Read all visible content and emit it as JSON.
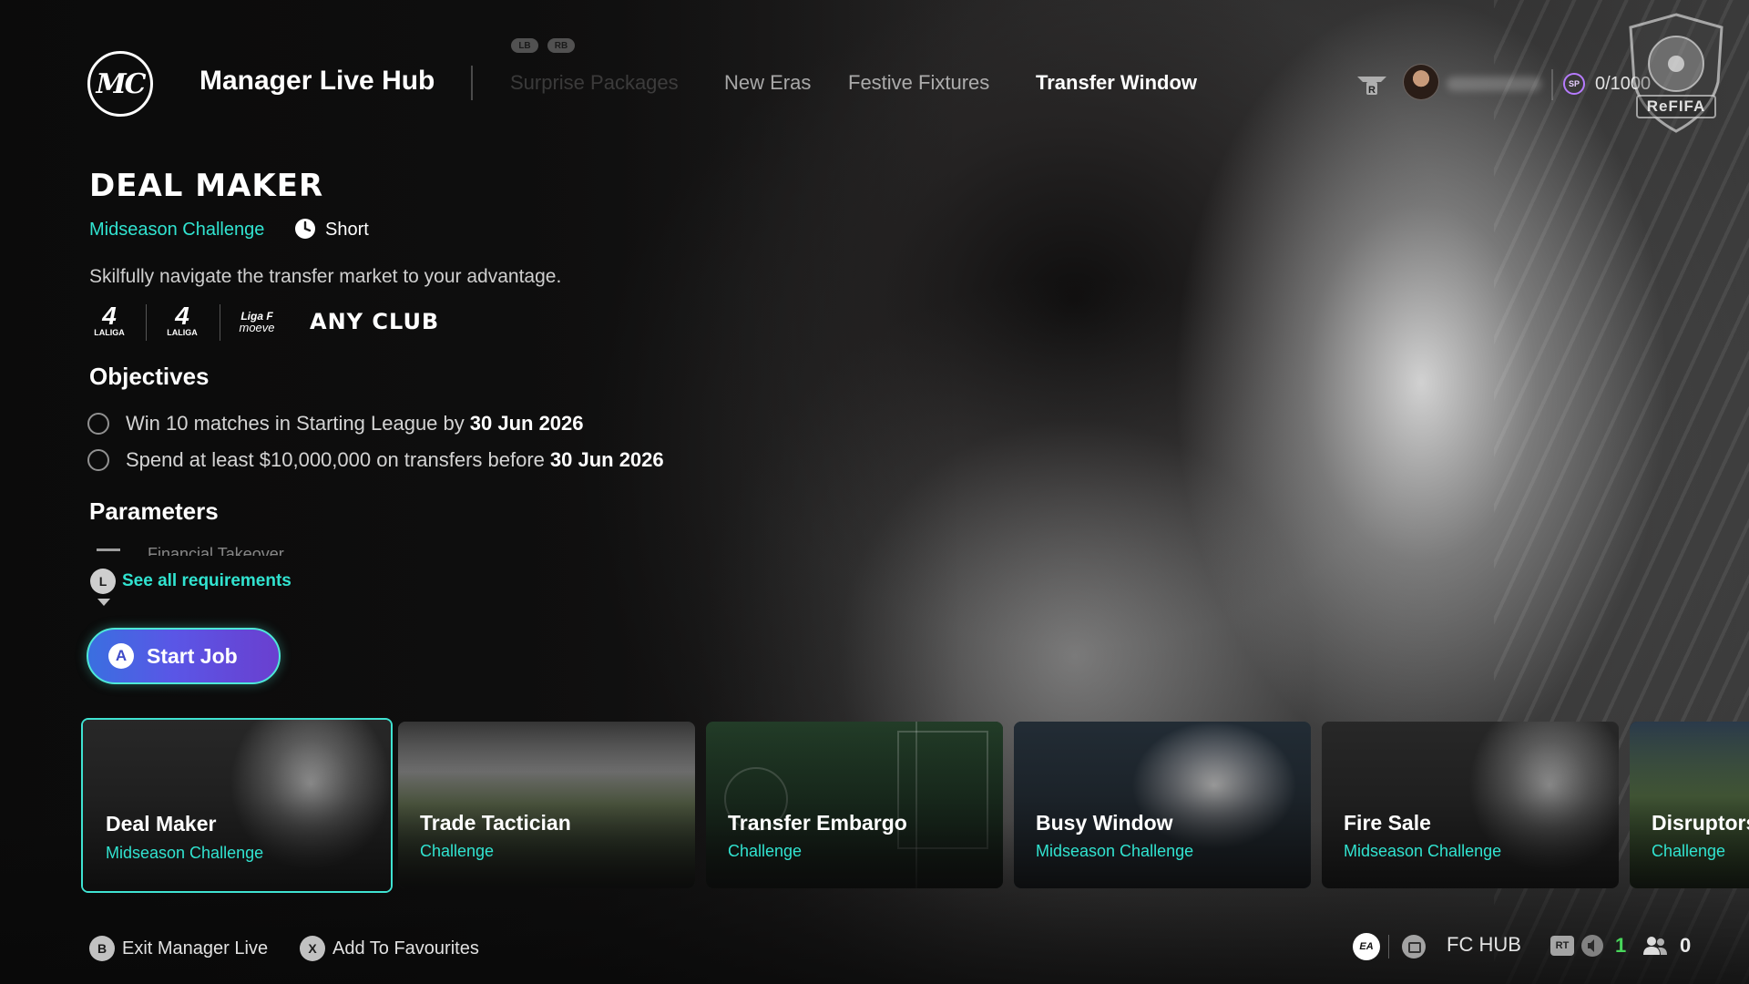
{
  "header": {
    "logo_text": "MC",
    "title": "Manager Live Hub",
    "bumper_left": "LB",
    "bumper_right": "RB",
    "tabs": [
      {
        "label": "Surprise Packages",
        "state": "faded"
      },
      {
        "label": "New Eras",
        "state": "inactive"
      },
      {
        "label": "Festive Fixtures",
        "state": "inactive"
      },
      {
        "label": "Transfer Window",
        "state": "active"
      }
    ],
    "sp_badge": "SP",
    "sp_progress": "0/1000",
    "watermark": "ReFIFA"
  },
  "job": {
    "title": "DEAL MAKER",
    "type": "Midseason Challenge",
    "duration": "Short",
    "description": "Skilfully navigate the transfer market to your advantage.",
    "leagues": [
      {
        "glyph": "4",
        "caption": "LALIGA"
      },
      {
        "glyph": "4",
        "caption": "LALIGA"
      },
      {
        "glyph": "Liga F",
        "caption": "moeve"
      }
    ],
    "club": "ANY CLUB",
    "objectives_title": "Objectives",
    "objectives": [
      {
        "text": "Win 10 matches in Starting League by",
        "date": "30 Jun 2026"
      },
      {
        "text": "Spend at least $10,000,000 on transfers before",
        "date": "30 Jun 2026"
      }
    ],
    "parameters_title": "Parameters",
    "parameter_first": "Financial Takeover",
    "see_all_glyph": "L",
    "see_all_label": "See all requirements",
    "start_glyph": "A",
    "start_label": "Start Job"
  },
  "cards": [
    {
      "name": "Deal Maker",
      "subtitle": "Midseason Challenge",
      "art": "stadium",
      "selected": true
    },
    {
      "name": "Trade Tactician",
      "subtitle": "Challenge",
      "art": "pitch",
      "selected": false
    },
    {
      "name": "Transfer Embargo",
      "subtitle": "Challenge",
      "art": "tactic-board",
      "selected": false
    },
    {
      "name": "Busy Window",
      "subtitle": "Midseason Challenge",
      "art": "snowy-seats",
      "selected": false
    },
    {
      "name": "Fire Sale",
      "subtitle": "Midseason Challenge",
      "art": "stadium",
      "selected": false
    },
    {
      "name": "Disruptors",
      "subtitle": "Challenge",
      "art": "grass",
      "selected": false
    }
  ],
  "footer": {
    "exit_glyph": "B",
    "exit_label": "Exit Manager Live",
    "fav_glyph": "X",
    "fav_label": "Add To Favourites",
    "ea_label": "EA",
    "fc_hub_label": "FC HUB",
    "rt_label": "RT",
    "voice_count": "1",
    "friends_count": "0"
  },
  "colors": {
    "accent_teal": "#31e3d0",
    "button_gradient_start": "#3a6fe0",
    "button_gradient_end": "#6a3fcf",
    "sp_purple": "#b67bff",
    "voice_green": "#48d65b"
  }
}
